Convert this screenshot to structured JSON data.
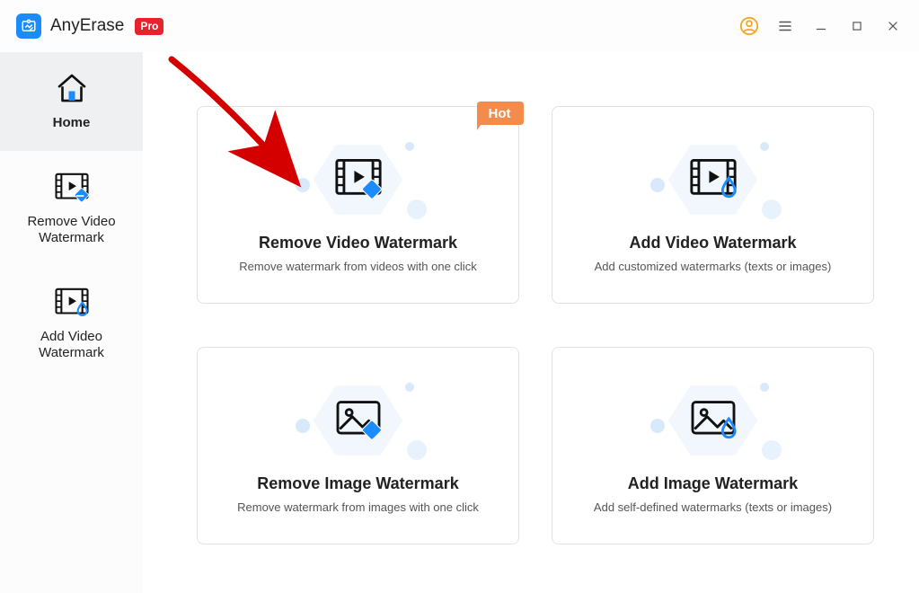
{
  "app": {
    "name": "AnyErase",
    "pro_label": "Pro"
  },
  "sidebar": {
    "items": [
      {
        "label": "Home"
      },
      {
        "label": "Remove Video Watermark"
      },
      {
        "label": "Add Video Watermark"
      }
    ]
  },
  "cards": [
    {
      "title": "Remove Video Watermark",
      "desc": "Remove watermark from videos with one click",
      "badge": "Hot",
      "kind": "video-remove"
    },
    {
      "title": "Add Video Watermark",
      "desc": "Add customized watermarks (texts or images)",
      "kind": "video-add"
    },
    {
      "title": "Remove Image Watermark",
      "desc": "Remove watermark from images with one click",
      "kind": "image-remove"
    },
    {
      "title": "Add Image Watermark",
      "desc": "Add self-defined watermarks  (texts or images)",
      "kind": "image-add"
    }
  ],
  "colors": {
    "accent_blue": "#1a8cff",
    "badge_red": "#e8222a",
    "hot_orange": "#f38b4c",
    "hex_bg": "#f1f7fd"
  }
}
